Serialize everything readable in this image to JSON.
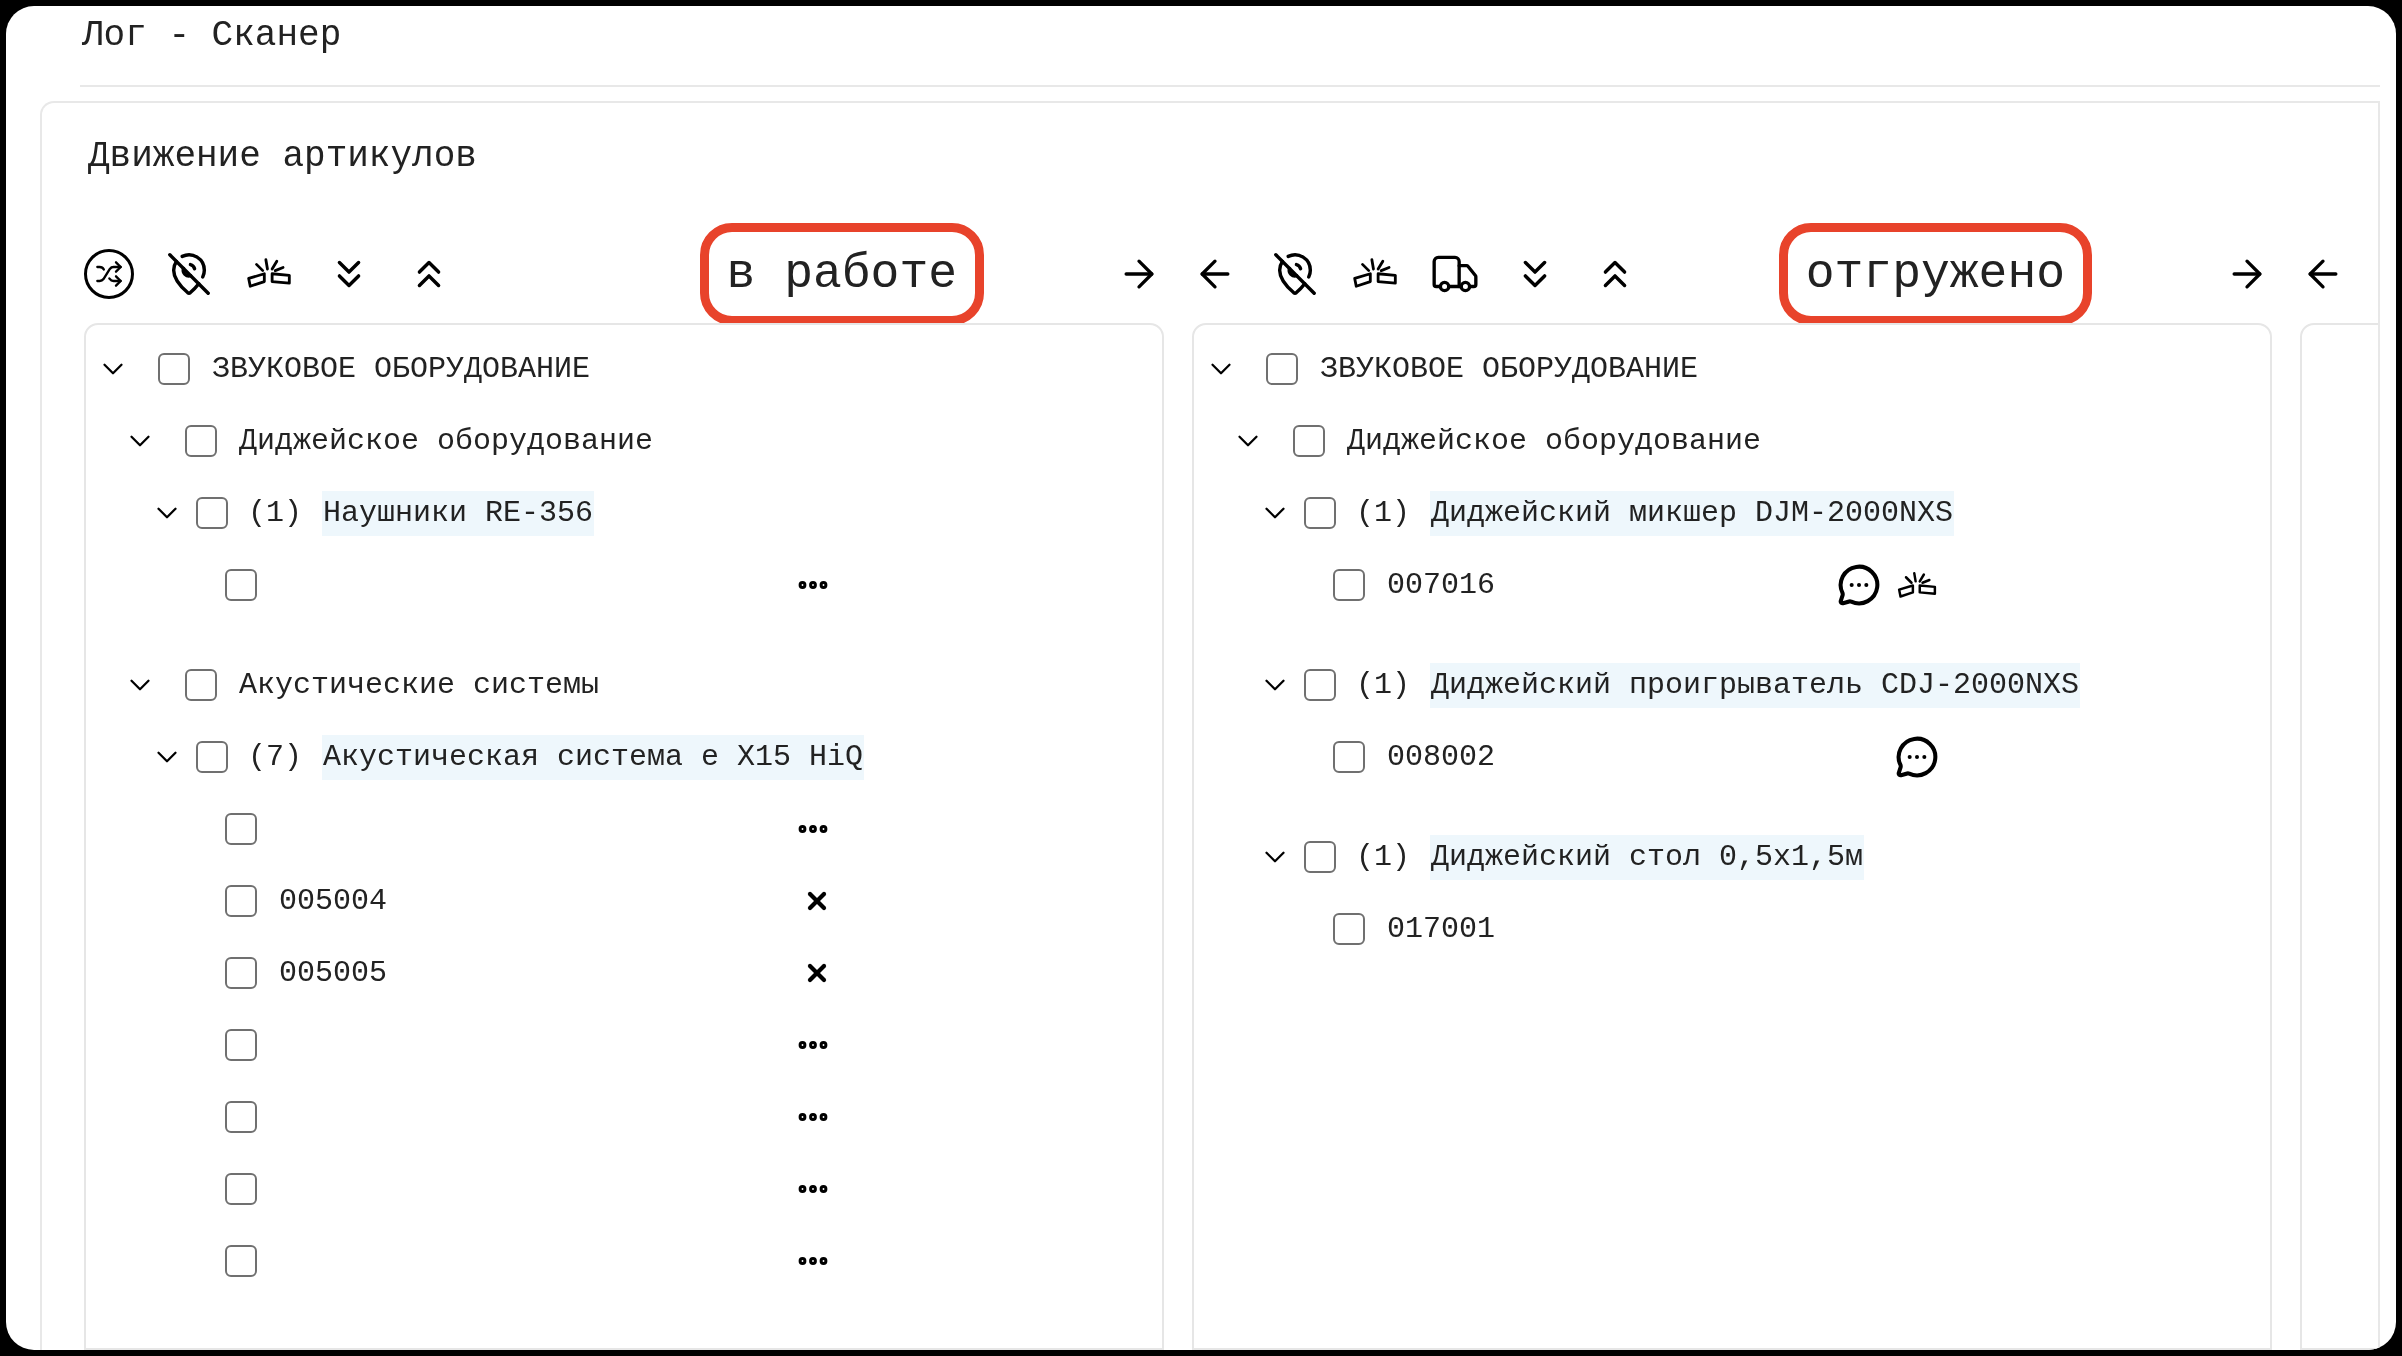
{
  "header": {
    "title": "Лог - Сканер"
  },
  "section": {
    "title": "Движение артикулов"
  },
  "panels": [
    {
      "back_arrow": false,
      "forward_arrow": true,
      "tools": [
        {
          "kind": "shuffle"
        },
        {
          "kind": "no-location"
        },
        {
          "kind": "broken"
        },
        {
          "kind": "expand"
        },
        {
          "kind": "collapse"
        }
      ],
      "status": "в работе",
      "tree": [
        {
          "kind": "group",
          "label": "ЗВУКОВОЕ ОБОРУДОВАНИЕ",
          "expanded": true,
          "checked": false,
          "children": [
            {
              "kind": "group",
              "label": "Диджейское оборудование",
              "expanded": true,
              "checked": false,
              "children": [
                {
                  "kind": "product",
                  "count": "(1)",
                  "name": "Наушники RE-356",
                  "expanded": true,
                  "checked": false,
                  "children": [
                    {
                      "kind": "item",
                      "checked": false,
                      "marks": [
                        {
                          "kind": "more"
                        }
                      ]
                    }
                  ]
                }
              ]
            },
            {
              "kind": "group",
              "label": "Акустические системы",
              "expanded": true,
              "checked": false,
              "children": [
                {
                  "kind": "product",
                  "count": "(7)",
                  "name": "Акустическая система e X15 HiQ",
                  "expanded": true,
                  "checked": false,
                  "children": [
                    {
                      "kind": "item",
                      "checked": false,
                      "marks": [
                        {
                          "kind": "more"
                        }
                      ]
                    },
                    {
                      "kind": "item",
                      "code": "005004",
                      "checked": false,
                      "marks": [
                        {
                          "kind": "remove"
                        }
                      ]
                    },
                    {
                      "kind": "item",
                      "code": "005005",
                      "checked": false,
                      "marks": [
                        {
                          "kind": "remove"
                        }
                      ]
                    },
                    {
                      "kind": "item",
                      "checked": false,
                      "marks": [
                        {
                          "kind": "more"
                        }
                      ]
                    },
                    {
                      "kind": "item",
                      "checked": false,
                      "marks": [
                        {
                          "kind": "more"
                        }
                      ]
                    },
                    {
                      "kind": "item",
                      "checked": false,
                      "marks": [
                        {
                          "kind": "more"
                        }
                      ]
                    },
                    {
                      "kind": "item",
                      "checked": false,
                      "marks": [
                        {
                          "kind": "more"
                        }
                      ]
                    }
                  ]
                }
              ]
            }
          ]
        }
      ]
    },
    {
      "back_arrow": true,
      "forward_arrow": true,
      "tools": [
        {
          "kind": "no-location"
        },
        {
          "kind": "broken"
        },
        {
          "kind": "truck"
        },
        {
          "kind": "expand"
        },
        {
          "kind": "collapse"
        }
      ],
      "status": "отгружено",
      "tree": [
        {
          "kind": "group",
          "label": "ЗВУКОВОЕ ОБОРУДОВАНИЕ",
          "expanded": true,
          "checked": false,
          "children": [
            {
              "kind": "group",
              "label": "Диджейское оборудование",
              "expanded": true,
              "checked": false,
              "children": [
                {
                  "kind": "product",
                  "count": "(1)",
                  "name": "Диджейский микшер DJM-2000NXS",
                  "expanded": true,
                  "checked": false,
                  "children": [
                    {
                      "kind": "item",
                      "code": "007016",
                      "checked": false,
                      "marks": [
                        {
                          "kind": "comment"
                        },
                        {
                          "kind": "broken"
                        }
                      ]
                    }
                  ]
                },
                {
                  "kind": "product",
                  "count": "(1)",
                  "name": "Диджейский проигрыватель CDJ-2000NXS",
                  "expanded": true,
                  "checked": false,
                  "children": [
                    {
                      "kind": "item",
                      "code": "008002",
                      "checked": false,
                      "marks": [
                        {
                          "kind": "comment"
                        }
                      ]
                    }
                  ]
                },
                {
                  "kind": "product",
                  "count": "(1)",
                  "name": "Диджейский стол 0,5x1,5м",
                  "expanded": true,
                  "checked": false,
                  "children": [
                    {
                      "kind": "item",
                      "code": "017001",
                      "checked": false
                    }
                  ]
                }
              ]
            }
          ]
        }
      ]
    },
    {
      "back_arrow": true,
      "forward_arrow": false
    }
  ]
}
